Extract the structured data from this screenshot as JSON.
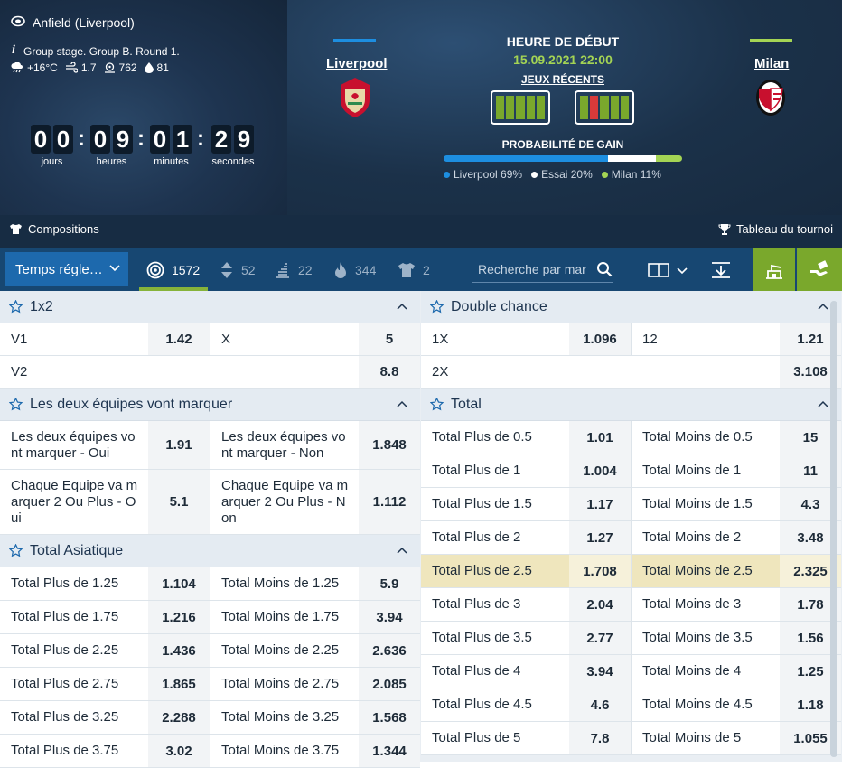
{
  "hero": {
    "venue": "Anfield (Liverpool)",
    "group": "Group stage. Group B. Round 1.",
    "weather": {
      "temp": "+16°C",
      "wind": "1.7",
      "pressure": "762",
      "humidity": "81"
    },
    "countdown": {
      "digits": [
        "0",
        "0",
        "0",
        "9",
        "0",
        "1",
        "2",
        "9"
      ],
      "labels": [
        "jours",
        "heures",
        "minutes",
        "secondes"
      ]
    },
    "home": {
      "name": "Liverpool",
      "color": "#1d8ee0"
    },
    "away": {
      "name": "Milan",
      "color": "#a4d454"
    },
    "start_title": "HEURE DE DÉBUT",
    "start_date": "15.09.2021 22:00",
    "recent_label": "JEUX RÉCENTS",
    "home_form": [
      "win",
      "win",
      "win",
      "win",
      "win"
    ],
    "away_form": [
      "win",
      "loss",
      "win",
      "win",
      "win"
    ],
    "prob_title": "PROBABILITÉ DE GAIN",
    "probabilities": [
      {
        "label": "Liverpool 69%",
        "value": 0.69,
        "color": "#1d8ee0"
      },
      {
        "label": "Essai 20%",
        "value": 0.2,
        "color": "#ffffff"
      },
      {
        "label": "Milan 11%",
        "value": 0.11,
        "color": "#a4d454"
      }
    ],
    "compositions": "Compositions",
    "tournament": "Tableau du tournoi"
  },
  "toolbar": {
    "dropdown": "Temps régle…",
    "counts": {
      "all": "1572",
      "handicap": "52",
      "stats": "22",
      "hot": "344",
      "kit": "2"
    },
    "search_placeholder": "Recherche par mar"
  },
  "markets": {
    "left": [
      {
        "title": "1x2",
        "rows": [
          [
            {
              "label": "V1",
              "odd": "1.42"
            },
            {
              "label": "X",
              "odd": "5"
            }
          ],
          [
            {
              "label": "V2",
              "odd": "8.8"
            }
          ]
        ]
      },
      {
        "title": "Les deux équipes vont marquer",
        "rows": [
          [
            {
              "label": "Les deux équipes vo\nnt marquer - Oui",
              "odd": "1.91"
            },
            {
              "label": "Les deux équipes vo\nnt marquer - Non",
              "odd": "1.848"
            }
          ],
          [
            {
              "label": "Chaque Equipe va m\narquer 2 Ou Plus - O\nui",
              "odd": "5.1"
            },
            {
              "label": "Chaque Equipe va m\narquer 2 Ou Plus - N\non",
              "odd": "1.112"
            }
          ]
        ]
      },
      {
        "title": "Total Asiatique",
        "rows": [
          [
            {
              "label": "Total Plus de 1.25",
              "odd": "1.104"
            },
            {
              "label": "Total Moins de 1.25",
              "odd": "5.9"
            }
          ],
          [
            {
              "label": "Total Plus de 1.75",
              "odd": "1.216"
            },
            {
              "label": "Total Moins de 1.75",
              "odd": "3.94"
            }
          ],
          [
            {
              "label": "Total Plus de 2.25",
              "odd": "1.436"
            },
            {
              "label": "Total Moins de 2.25",
              "odd": "2.636"
            }
          ],
          [
            {
              "label": "Total Plus de 2.75",
              "odd": "1.865"
            },
            {
              "label": "Total Moins de 2.75",
              "odd": "2.085"
            }
          ],
          [
            {
              "label": "Total Plus de 3.25",
              "odd": "2.288"
            },
            {
              "label": "Total Moins de 3.25",
              "odd": "1.568"
            }
          ],
          [
            {
              "label": "Total Plus de 3.75",
              "odd": "3.02"
            },
            {
              "label": "Total Moins de 3.75",
              "odd": "1.344"
            }
          ]
        ]
      }
    ],
    "right": [
      {
        "title": "Double chance",
        "rows": [
          [
            {
              "label": "1X",
              "odd": "1.096"
            },
            {
              "label": "12",
              "odd": "1.21"
            }
          ],
          [
            {
              "label": "2X",
              "odd": "3.108"
            }
          ]
        ]
      },
      {
        "title": "Total",
        "rows": [
          [
            {
              "label": "Total Plus de 0.5",
              "odd": "1.01"
            },
            {
              "label": "Total Moins de 0.5",
              "odd": "15"
            }
          ],
          [
            {
              "label": "Total Plus de 1",
              "odd": "1.004"
            },
            {
              "label": "Total Moins de 1",
              "odd": "11"
            }
          ],
          [
            {
              "label": "Total Plus de 1.5",
              "odd": "1.17"
            },
            {
              "label": "Total Moins de 1.5",
              "odd": "4.3"
            }
          ],
          [
            {
              "label": "Total Plus de 2",
              "odd": "1.27"
            },
            {
              "label": "Total Moins de 2",
              "odd": "3.48"
            }
          ],
          [
            {
              "label": "Total Plus de 2.5",
              "odd": "1.708",
              "highlight": true
            },
            {
              "label": "Total Moins de 2.5",
              "odd": "2.325",
              "highlight": true
            }
          ],
          [
            {
              "label": "Total Plus de 3",
              "odd": "2.04"
            },
            {
              "label": "Total Moins de 3",
              "odd": "1.78"
            }
          ],
          [
            {
              "label": "Total Plus de 3.5",
              "odd": "2.77"
            },
            {
              "label": "Total Moins de 3.5",
              "odd": "1.56"
            }
          ],
          [
            {
              "label": "Total Plus de 4",
              "odd": "3.94"
            },
            {
              "label": "Total Moins de 4",
              "odd": "1.25"
            }
          ],
          [
            {
              "label": "Total Plus de 4.5",
              "odd": "4.6"
            },
            {
              "label": "Total Moins de 4.5",
              "odd": "1.18"
            }
          ],
          [
            {
              "label": "Total Plus de 5",
              "odd": "7.8"
            },
            {
              "label": "Total Moins de 5",
              "odd": "1.055"
            }
          ]
        ]
      }
    ]
  }
}
